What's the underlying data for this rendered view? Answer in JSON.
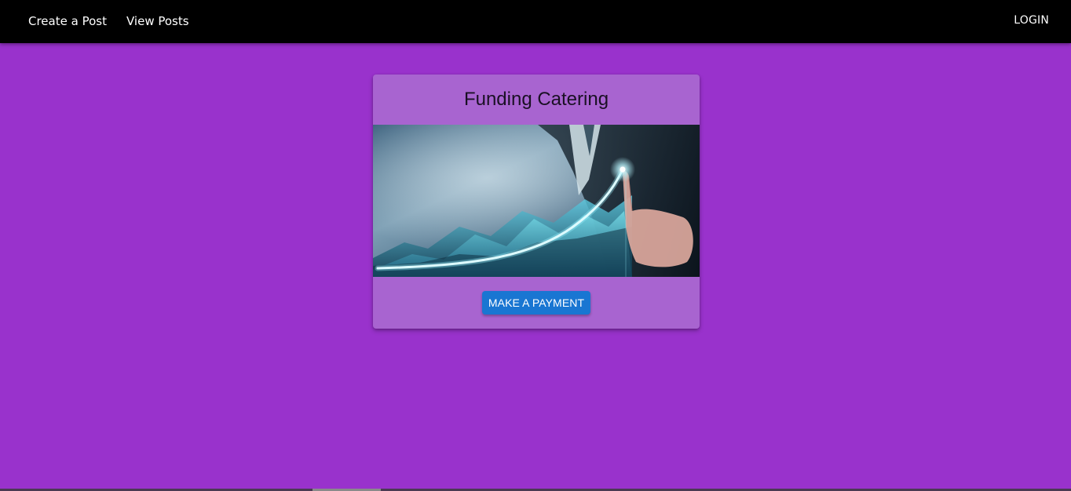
{
  "navbar": {
    "links": [
      {
        "label": "Create a Post"
      },
      {
        "label": "View Posts"
      }
    ],
    "login_label": "LOGIN"
  },
  "card": {
    "title": "Funding Catering",
    "image": "business-growth-chart-image",
    "button_label": "MAKE A PAYMENT"
  },
  "colors": {
    "page_background": "#9932CC",
    "navbar_background": "#000000",
    "card_background": "#A864D0",
    "button_background": "#1976D2"
  }
}
